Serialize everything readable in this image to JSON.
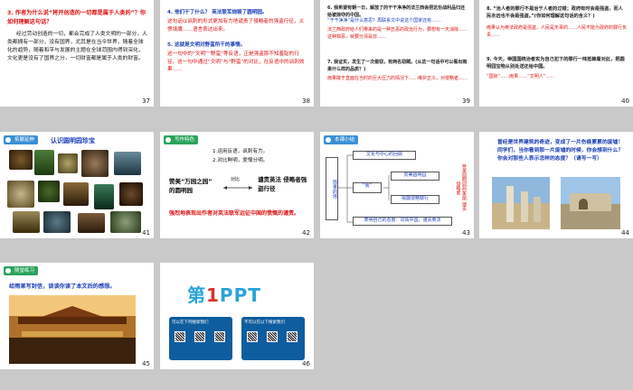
{
  "slides": [
    {
      "num": "37",
      "title": "3. 作者为什么说“将开创造的一切都是属于人类的”？你如何理解这句话？",
      "body": "经过劳动创造的一切，都会完成了人类文明的一部分，人类都拥有一部分，没有国界，尤其是在当今世界，随着全球化的趋势，随着和平与发展的主题在全球范围内得到深化，文化更是没有了国界之分，一切财富都是属于人类的财富。"
    },
    {
      "num": "38",
      "items": [
        "4. 他们干了什么？ 英法联军烧毁了圆明园。",
        "这句话以讽刺的形式更加有力地谴责了侵略者的强盗行径，义愤填膺……语言表达出来。",
        "5. 这就是文明对野蛮所干的事情。",
        "这一句中的“文明”“野蛮”等反语，正是强盗那不知羞耻的行径。这一句中通过“文明”与“野蛮”的对比，在反语中的讽刺效果……"
      ]
    },
    {
      "num": "39",
      "q1": "6. 我希望有朝一日，解放了的干干净净的法兰西会把这份战利品归还给被掠夺的中国。",
      "q1b": "“干干净净”是什么意思？再联系文中说这个国家还有……",
      "a1": "法兰西政府给人们带来的是一种丑恶的政治行为，要想有一天消除……这种罪恶，就要分清是非……",
      "q2": "7. 我证实，发生了一次偷窃，有两名窃贼。(从这一句话中可以看出雨果什么样的品质？)",
      "a2": "雨果敢于直面在当时的巨大压力的情况下……维护正义，对侵略者……"
    },
    {
      "num": "40",
      "q1": "8. “治人者的罪行不是治于人者的过错；政府有时会是强盗，而人民永远也不会是强盗。”(你如何理解这句话的含义？)",
      "a1": "雨果认为英法政府是强盗，人民是无辜的……人民不能为政府的罪行负责……",
      "q2": "9. 今天，帝国国统治者实为自己犯下的罪行一味抵赖着对此，把圆明园宝物从别处送还给中国。",
      "a2": "“国际”……雨果……“文明人”……"
    },
    {
      "num": "41",
      "tag": "拓展延伸",
      "title": "认识圆明园珍宝"
    },
    {
      "num": "42",
      "tag": "写作特色",
      "points": [
        "1.运用反语，讽刺有力。",
        "2.对比鲜明，爱憎分明。"
      ],
      "left": "赞美“万园之园” 的圆明园",
      "vs": "对比",
      "right": "谴责英法 侵略者强 盗行径",
      "summary": "强烈地表现出作者对英法联军远征中国的愤慨的谴责。"
    },
    {
      "num": "43",
      "tag": "本课小结",
      "root": "雨果的信",
      "n1": "文化与中心的回顾",
      "n2": "赞美圆明园",
      "n3": "揭露侵略罪行",
      "n4": "表明自己的态度：同情中国，谴责英法",
      "side": "赞美圆明园的美丽  谴责侵略者"
    },
    {
      "num": "44",
      "body": "曾经是世界建筑的奇迹，变成了一片伤痕累累的废墟！同学们，当你看到那一片废墟的时候，你会想到什么？你会对那些人表示怎样的态度？（请写一写）"
    },
    {
      "num": "45",
      "tag": "随堂练习",
      "title": "给雨果写封信，谈谈你读了本文后的感想。"
    },
    {
      "num": "46",
      "logo": [
        "第",
        "1",
        "PPT"
      ],
      "box1": "可以在下列搜索我们",
      "box2": "不可以在以下搜索我们"
    }
  ],
  "colors": {
    "red": "#d11111",
    "blue": "#1a3db7",
    "tag": "#3a8fd6",
    "tag_green": "#2aa35c",
    "canvas": "#c9c9c9"
  }
}
